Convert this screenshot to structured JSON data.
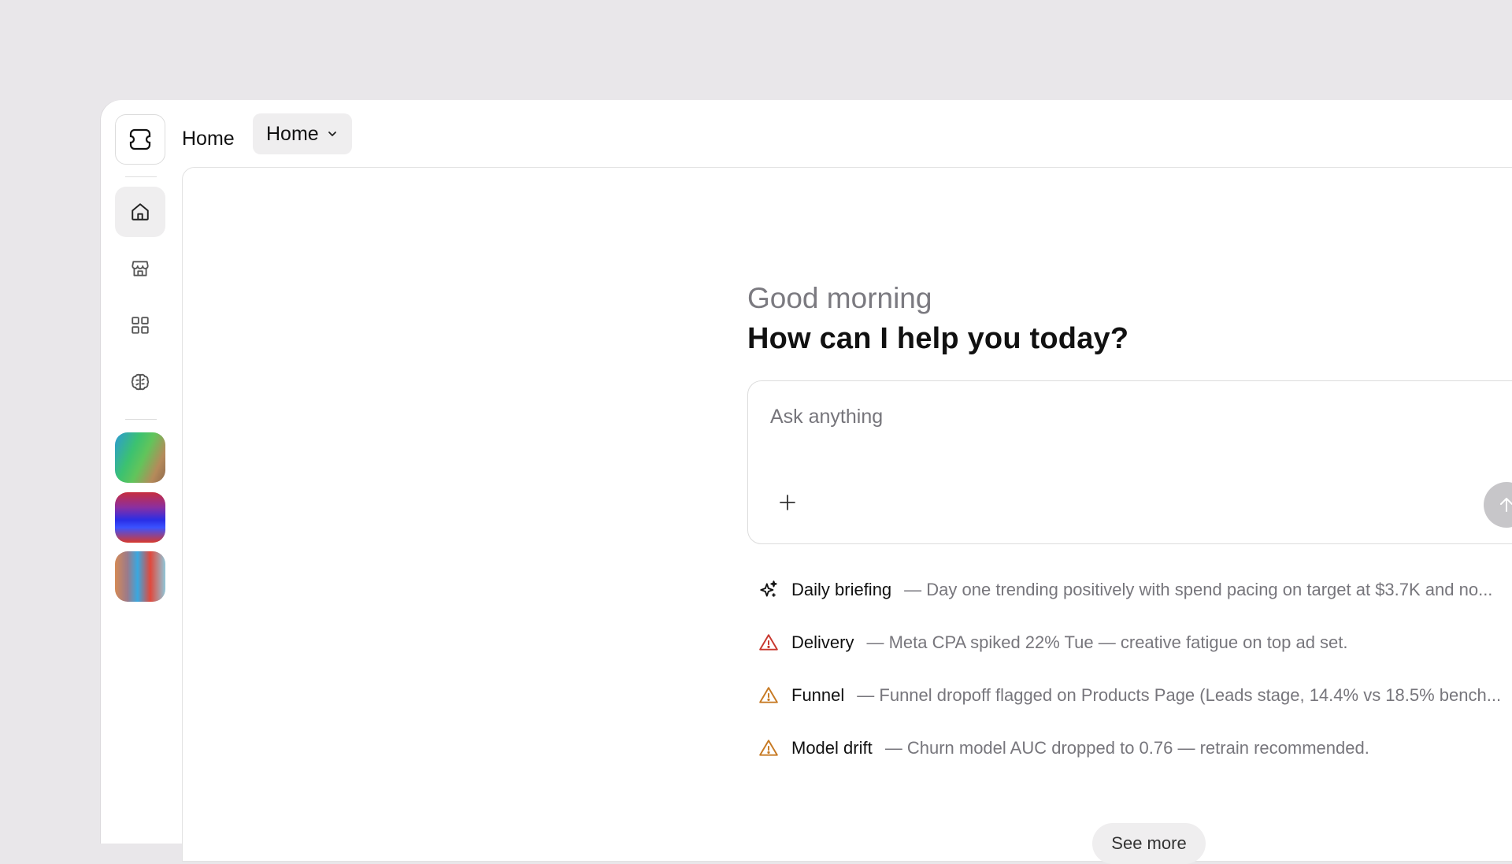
{
  "header": {
    "breadcrumb": "Home",
    "dropdown_label": "Home"
  },
  "sidebar": {
    "logo": "app-logo-icon",
    "items": [
      {
        "icon": "home-icon",
        "active": true
      },
      {
        "icon": "store-icon",
        "active": false
      },
      {
        "icon": "apps-grid-icon",
        "active": false
      },
      {
        "icon": "brain-icon",
        "active": false
      }
    ],
    "avatars": [
      "workspace-avatar-1",
      "workspace-avatar-2",
      "workspace-avatar-3"
    ]
  },
  "main": {
    "greeting": "Good morning",
    "headline": "How can I help you today?",
    "chat": {
      "placeholder": "Ask anything",
      "value": ""
    },
    "insights": [
      {
        "icon": "sparkle-icon",
        "title": "Daily briefing",
        "description": "— Day one trending positively with spend pacing on target at $3.7K and no..."
      },
      {
        "icon": "warning-icon",
        "color": "#c8382f",
        "title": "Delivery",
        "description": "— Meta CPA spiked 22% Tue — creative fatigue on top ad set."
      },
      {
        "icon": "warning-icon",
        "color": "#c77a24",
        "title": "Funnel",
        "description": "— Funnel dropoff flagged on Products Page (Leads stage, 14.4% vs 18.5% bench..."
      },
      {
        "icon": "warning-icon",
        "color": "#c77a24",
        "title": "Model drift",
        "description": "— Churn model AUC dropped to 0.76 — retrain recommended."
      }
    ],
    "see_more_label": "See more"
  },
  "colors": {
    "background": "#e9e7ea",
    "danger": "#c8382f",
    "warning": "#c77a24",
    "muted_text": "#77767c"
  }
}
